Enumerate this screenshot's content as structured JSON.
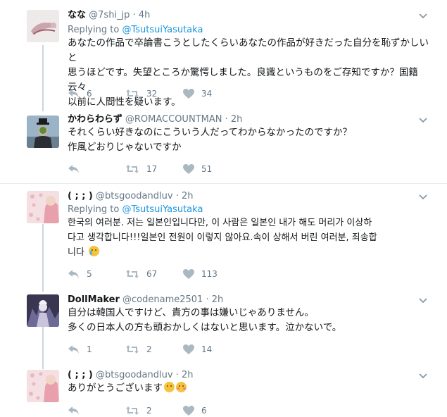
{
  "tweets": [
    {
      "name": "なな",
      "handle": "@7shi_jp",
      "time": "· 4h",
      "replying_prefix": "Replying to ",
      "replying_to": "@TsutsuiYasutaka",
      "lines": [
        "あなたの作品で卒論書こうとしたくらいあなたの作品が好きだった自分を恥ずかしいと",
        "思うほどです。失望ところか驚愕しました。良識というものをご存知ですか？国籍云々",
        "以前に人間性を疑います。"
      ],
      "replies": "6",
      "retweets": "32",
      "likes": "34"
    },
    {
      "name": "かわらわらず",
      "handle": "@ROMACCOUNTMAN",
      "time": "· 2h",
      "lines": [
        "それくらい好きなのにこういう人だってわからなかったのですか？",
        "作風どおりじゃないですか"
      ],
      "replies": "",
      "retweets": "17",
      "likes": "51"
    },
    {
      "name": "( ; ; )",
      "handle": "@btsgoodandluv",
      "time": "· 2h",
      "replying_prefix": "Replying to ",
      "replying_to": "@TsutsuiYasutaka",
      "lines": [
        "한국의 여러분. 저는 일본인입니다만, 이 사람은 일본인 내가 해도 머리가 이상하",
        "다고 생각합니다!!!일본인 전원이 이렇지 않아요.속이 상해서 버린 여러분, 죄송합",
        "니다"
      ],
      "replies": "5",
      "retweets": "67",
      "likes": "113"
    },
    {
      "name": "DollMaker",
      "handle": "@codename2501",
      "time": "· 2h",
      "lines": [
        "自分は韓国人ですけど、貴方の事は嫌いじゃありません。",
        "多くの日本人の方も頭おかしくはないと思います。泣かないで。"
      ],
      "replies": "1",
      "retweets": "2",
      "likes": "14"
    },
    {
      "name": "( ; ; )",
      "handle": "@btsgoodandluv",
      "time": "· 2h",
      "lines": [
        "ありがとうございます"
      ],
      "replies": "",
      "retweets": "2",
      "likes": "6"
    }
  ]
}
